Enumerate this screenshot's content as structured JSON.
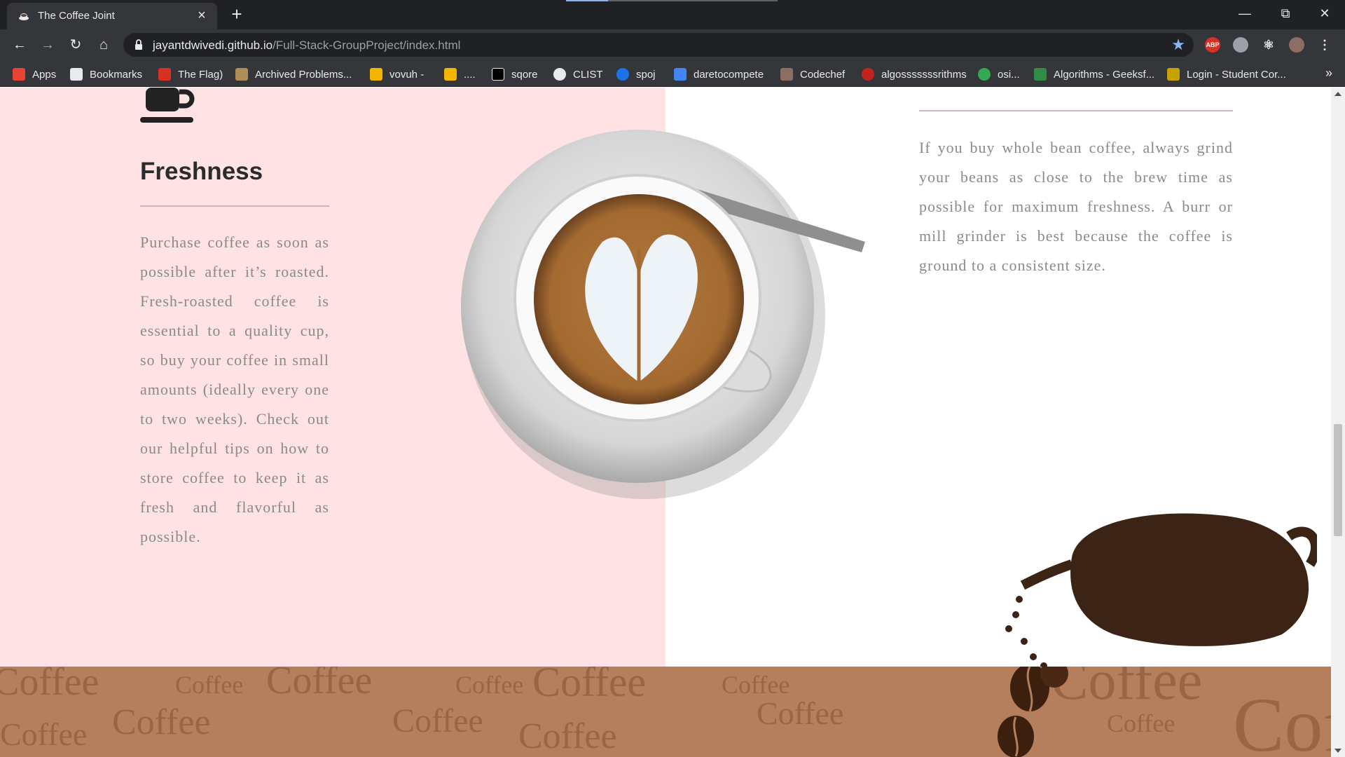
{
  "browser": {
    "tab_title": "The Coffee Joint",
    "url_host": "jayantdwivedi.github.io",
    "url_path": "/Full-Stack-GroupProject/index.html",
    "extension_abp_label": "ABP",
    "bookmarks": [
      {
        "label": "Apps",
        "icon": "apps-grid-icon",
        "color": "#ea4335"
      },
      {
        "label": "Bookmarks",
        "icon": "star-icon",
        "color": "#e8eaed"
      },
      {
        "label": "The Flag)",
        "icon": "flag-icon",
        "color": "#d93025"
      },
      {
        "label": "Archived Problems...",
        "icon": "archive-icon",
        "color": "#b08d57"
      },
      {
        "label": "vovuh -",
        "icon": "codeforces-icon",
        "color": "#f4b400"
      },
      {
        "label": "....",
        "icon": "codeforces-icon",
        "color": "#f4b400"
      },
      {
        "label": "sqore",
        "icon": "sqore-icon",
        "color": "#000000"
      },
      {
        "label": "CLIST",
        "icon": "globe-icon",
        "color": "#e8eaed"
      },
      {
        "label": "spoj",
        "icon": "spoj-icon",
        "color": "#1a73e8"
      },
      {
        "label": "daretocompete",
        "icon": "puzzle-icon",
        "color": "#4285f4"
      },
      {
        "label": "Codechef",
        "icon": "codechef-icon",
        "color": "#8d6e63"
      },
      {
        "label": "algosssssssrithms",
        "icon": "search-icon",
        "color": "#c5221f"
      },
      {
        "label": "osi...",
        "icon": "osi-icon",
        "color": "#34a853"
      },
      {
        "label": "Algorithms - Geeksf...",
        "icon": "geeksforgeeks-icon",
        "color": "#2f8d46"
      },
      {
        "label": "Login - Student Cor...",
        "icon": "student-icon",
        "color": "#c8a200"
      }
    ]
  },
  "page": {
    "freshness": {
      "heading": "Freshness",
      "text": "Purchase coffee as soon as possible after it’s roasted.  Fresh-roasted coffee is essential to a quality cup, so buy your coffee in small amounts (ideally every one to two weeks). Check out our helpful tips on how to store coffee to keep it as fresh and flavorful as possible."
    },
    "grind": {
      "text": "If you buy whole bean coffee, always grind your beans as close to the brew time as possible for maximum freshness. A burr or mill grinder is best because the coffee is ground to a consistent size."
    },
    "banner_word": "Coffee",
    "colors": {
      "pink_background": "#fee2e4",
      "banner_brown": "#b57e5c",
      "text_gray": "#8a8a8a"
    }
  }
}
